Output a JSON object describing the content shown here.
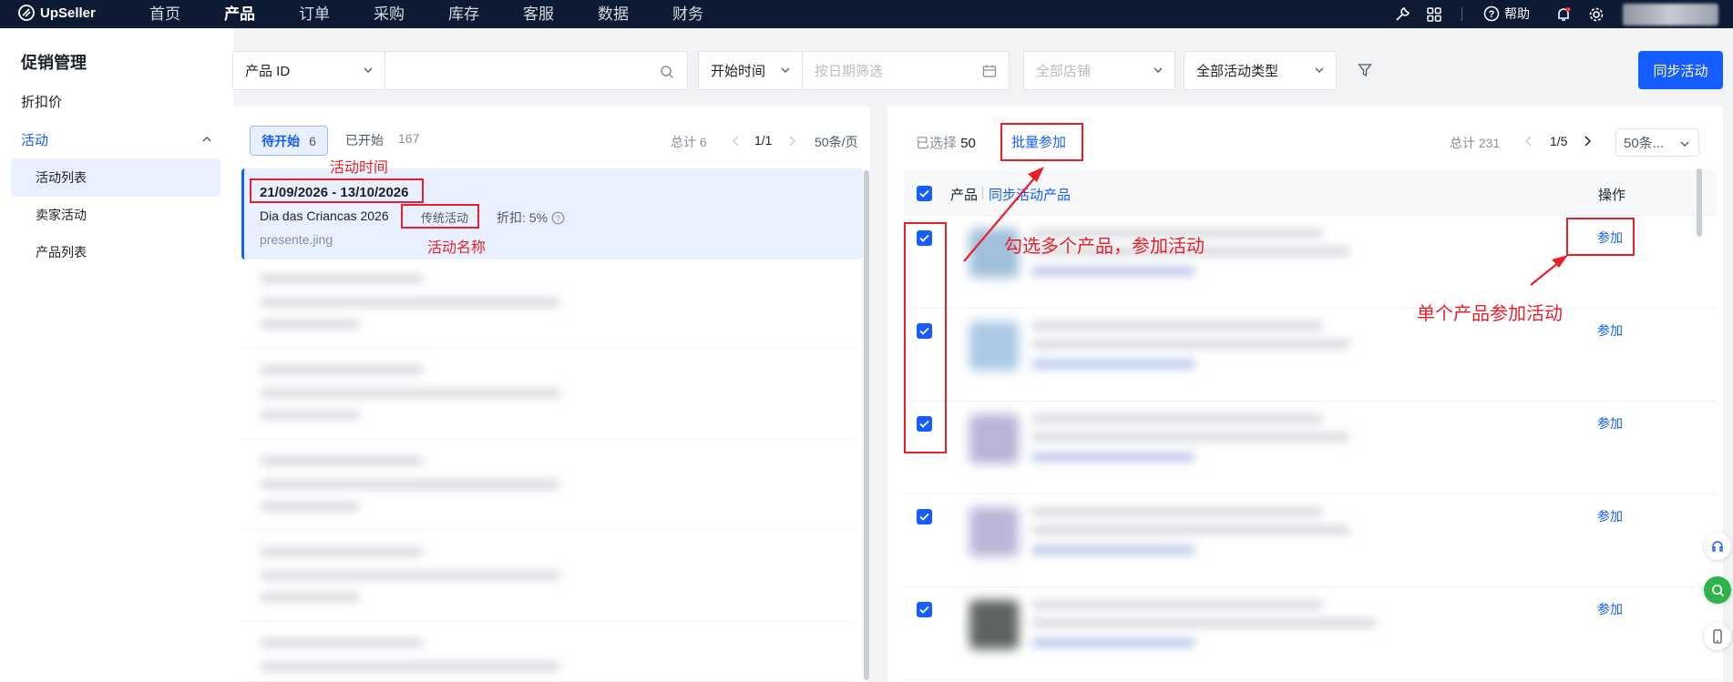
{
  "app": {
    "logo": "UpSeller"
  },
  "nav": {
    "items": [
      "首页",
      "产品",
      "订单",
      "采购",
      "库存",
      "客服",
      "数据",
      "财务"
    ],
    "active_index": 1
  },
  "header": {
    "help_label": "帮助"
  },
  "sidebar": {
    "title": "促销管理",
    "discount_label": "折扣价",
    "activity_group": "活动",
    "sub_items": [
      "活动列表",
      "卖家活动",
      "产品列表"
    ],
    "active_sub": 0
  },
  "filters": {
    "field_select": "产品 ID",
    "search_value": "",
    "time_select": "开始时间",
    "date_placeholder": "按日期筛选",
    "store_select": "全部店铺",
    "type_select": "全部活动类型"
  },
  "sync_button": "同步活动",
  "left_panel": {
    "tab_pending_label": "待开始",
    "tab_pending_count": "6",
    "tab_started_label": "已开始",
    "tab_started_count": "167",
    "total": "总计 6",
    "page": "1/1",
    "page_size": "50条/页",
    "event": {
      "date_range": "21/09/2026 - 13/10/2026",
      "name": "Dia das Criancas 2026",
      "type": "传统活动",
      "discount": "折扣: 5%",
      "shop": "presente.jing"
    }
  },
  "right_panel": {
    "selected_label": "已选择",
    "selected_count": "50",
    "batch_join": "批量参加",
    "total": "总计 231",
    "page": "1/5",
    "page_size": "50条...",
    "col_product": "产品",
    "col_sync": "同步活动产品",
    "col_action": "操作",
    "join_label": "参加"
  },
  "annotations": {
    "activity_time": "活动时间",
    "activity_name": "活动名称",
    "multi_select": "勾选多个产品，参加活动",
    "single_join": "单个产品参加活动"
  },
  "colors": {
    "primary": "#165dff",
    "topbar": "#0c1a33",
    "annotation": "#e8202a"
  }
}
